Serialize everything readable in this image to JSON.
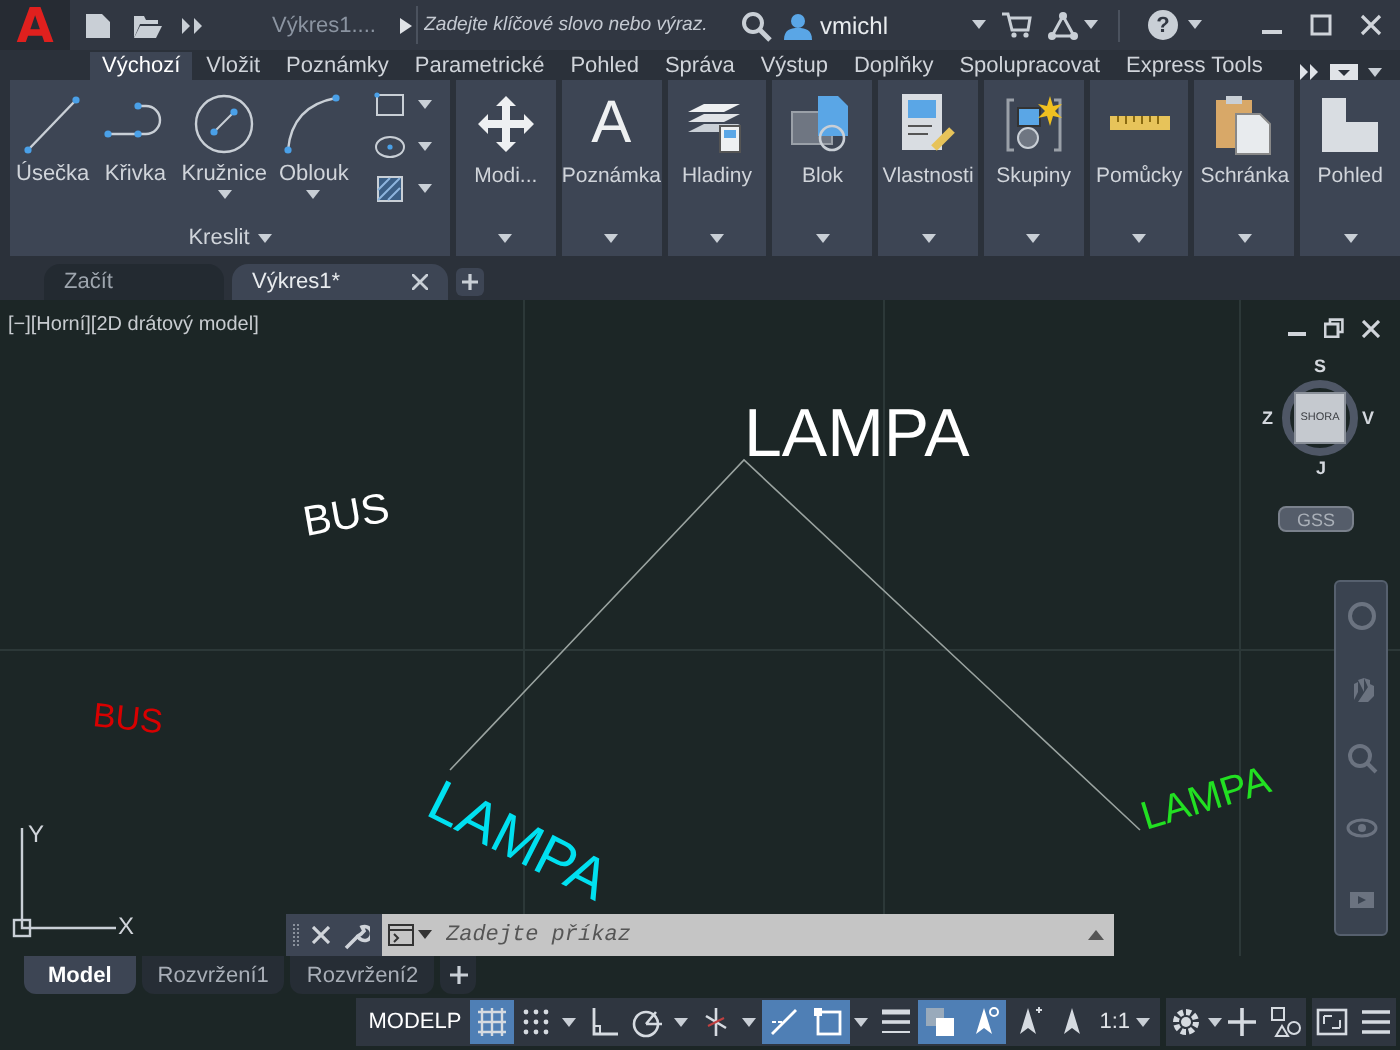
{
  "title_bar": {
    "logo": "A",
    "document": "Výkres1....",
    "search": {
      "placeholder": "Zadejte klíčové slovo nebo výraz."
    },
    "user": "vmichl",
    "help": "?"
  },
  "ribbon": {
    "tabs": [
      {
        "label": "Výchozí",
        "selected": true
      },
      {
        "label": "Vložit",
        "selected": false
      },
      {
        "label": "Poznámky",
        "selected": false
      },
      {
        "label": "Parametrické",
        "selected": false
      },
      {
        "label": "Pohled",
        "selected": false
      },
      {
        "label": "Správa",
        "selected": false
      },
      {
        "label": "Výstup",
        "selected": false
      },
      {
        "label": "Doplňky",
        "selected": false
      },
      {
        "label": "Spolupracovat",
        "selected": false
      },
      {
        "label": "Express Tools",
        "selected": false
      }
    ],
    "draw_panel": {
      "title": "Kreslit",
      "tools": [
        {
          "kind": "line",
          "label": "Úsečka",
          "dropdown": false
        },
        {
          "kind": "polyline",
          "label": "Křivka",
          "dropdown": false
        },
        {
          "kind": "circle",
          "label": "Kružnice",
          "dropdown": true
        },
        {
          "kind": "arc",
          "label": "Oblouk",
          "dropdown": true
        }
      ],
      "small_tools": [
        {
          "kind": "rectangle"
        },
        {
          "kind": "ellipse"
        },
        {
          "kind": "hatch"
        }
      ]
    },
    "panels": [
      {
        "kind": "move",
        "label": "Modi..."
      },
      {
        "kind": "text",
        "label": "Poznámka",
        "glyph": "A"
      },
      {
        "kind": "layers",
        "label": "Hladiny"
      },
      {
        "kind": "block",
        "label": "Blok"
      },
      {
        "kind": "properties",
        "label": "Vlastnosti"
      },
      {
        "kind": "groups",
        "label": "Skupiny"
      },
      {
        "kind": "measure",
        "label": "Pomůcky"
      },
      {
        "kind": "clipboard",
        "label": "Schránka"
      },
      {
        "kind": "view",
        "label": "Pohled"
      }
    ]
  },
  "document_tabs": [
    {
      "label": "Začít",
      "selected": false,
      "closable": false
    },
    {
      "label": "Výkres1*",
      "selected": true,
      "closable": true
    }
  ],
  "viewport": {
    "controls": [
      "[−]",
      "[Horní]",
      "[2D drátový model]"
    ],
    "texts": [
      {
        "text": "LAMPA",
        "color": "#ffffff"
      },
      {
        "text": "BUS",
        "color": "#ffffff"
      },
      {
        "text": "BUS",
        "color": "#d80000"
      },
      {
        "text": "LAMPA",
        "color": "#00e0f0"
      },
      {
        "text": "LAMPA",
        "color": "#22e022"
      }
    ],
    "viewcube": {
      "north": "S",
      "east": "V",
      "south": "J",
      "west": "Z",
      "face": "SHORA"
    },
    "ucs_menu": "GSS",
    "ucs_axes": {
      "x": "X",
      "y": "Y"
    }
  },
  "command_line": {
    "placeholder": "Zadejte příkaz"
  },
  "layout_tabs": [
    {
      "label": "Model",
      "selected": true
    },
    {
      "label": "Rozvržení1",
      "selected": false
    },
    {
      "label": "Rozvržení2",
      "selected": false
    }
  ],
  "status_bar": {
    "model": "MODELP",
    "scale": "1:1",
    "toggles": [
      {
        "kind": "grid",
        "on": true,
        "dropdown": false
      },
      {
        "kind": "snap",
        "on": false,
        "dropdown": true
      },
      {
        "kind": "ortho",
        "on": false,
        "dropdown": false
      },
      {
        "kind": "polar",
        "on": false,
        "dropdown": true
      },
      {
        "kind": "isodraft",
        "on": false,
        "dropdown": true
      },
      {
        "kind": "tracking",
        "on": true,
        "dropdown": false
      },
      {
        "kind": "osnap",
        "on": true,
        "dropdown": true
      },
      {
        "kind": "lineweight",
        "on": false,
        "dropdown": false
      },
      {
        "kind": "transparency",
        "on": true,
        "dropdown": false
      },
      {
        "kind": "annotation",
        "on": true,
        "dropdown": false
      },
      {
        "kind": "autoscale",
        "on": false,
        "dropdown": false
      },
      {
        "kind": "annoscale",
        "on": false,
        "dropdown": false
      }
    ]
  }
}
